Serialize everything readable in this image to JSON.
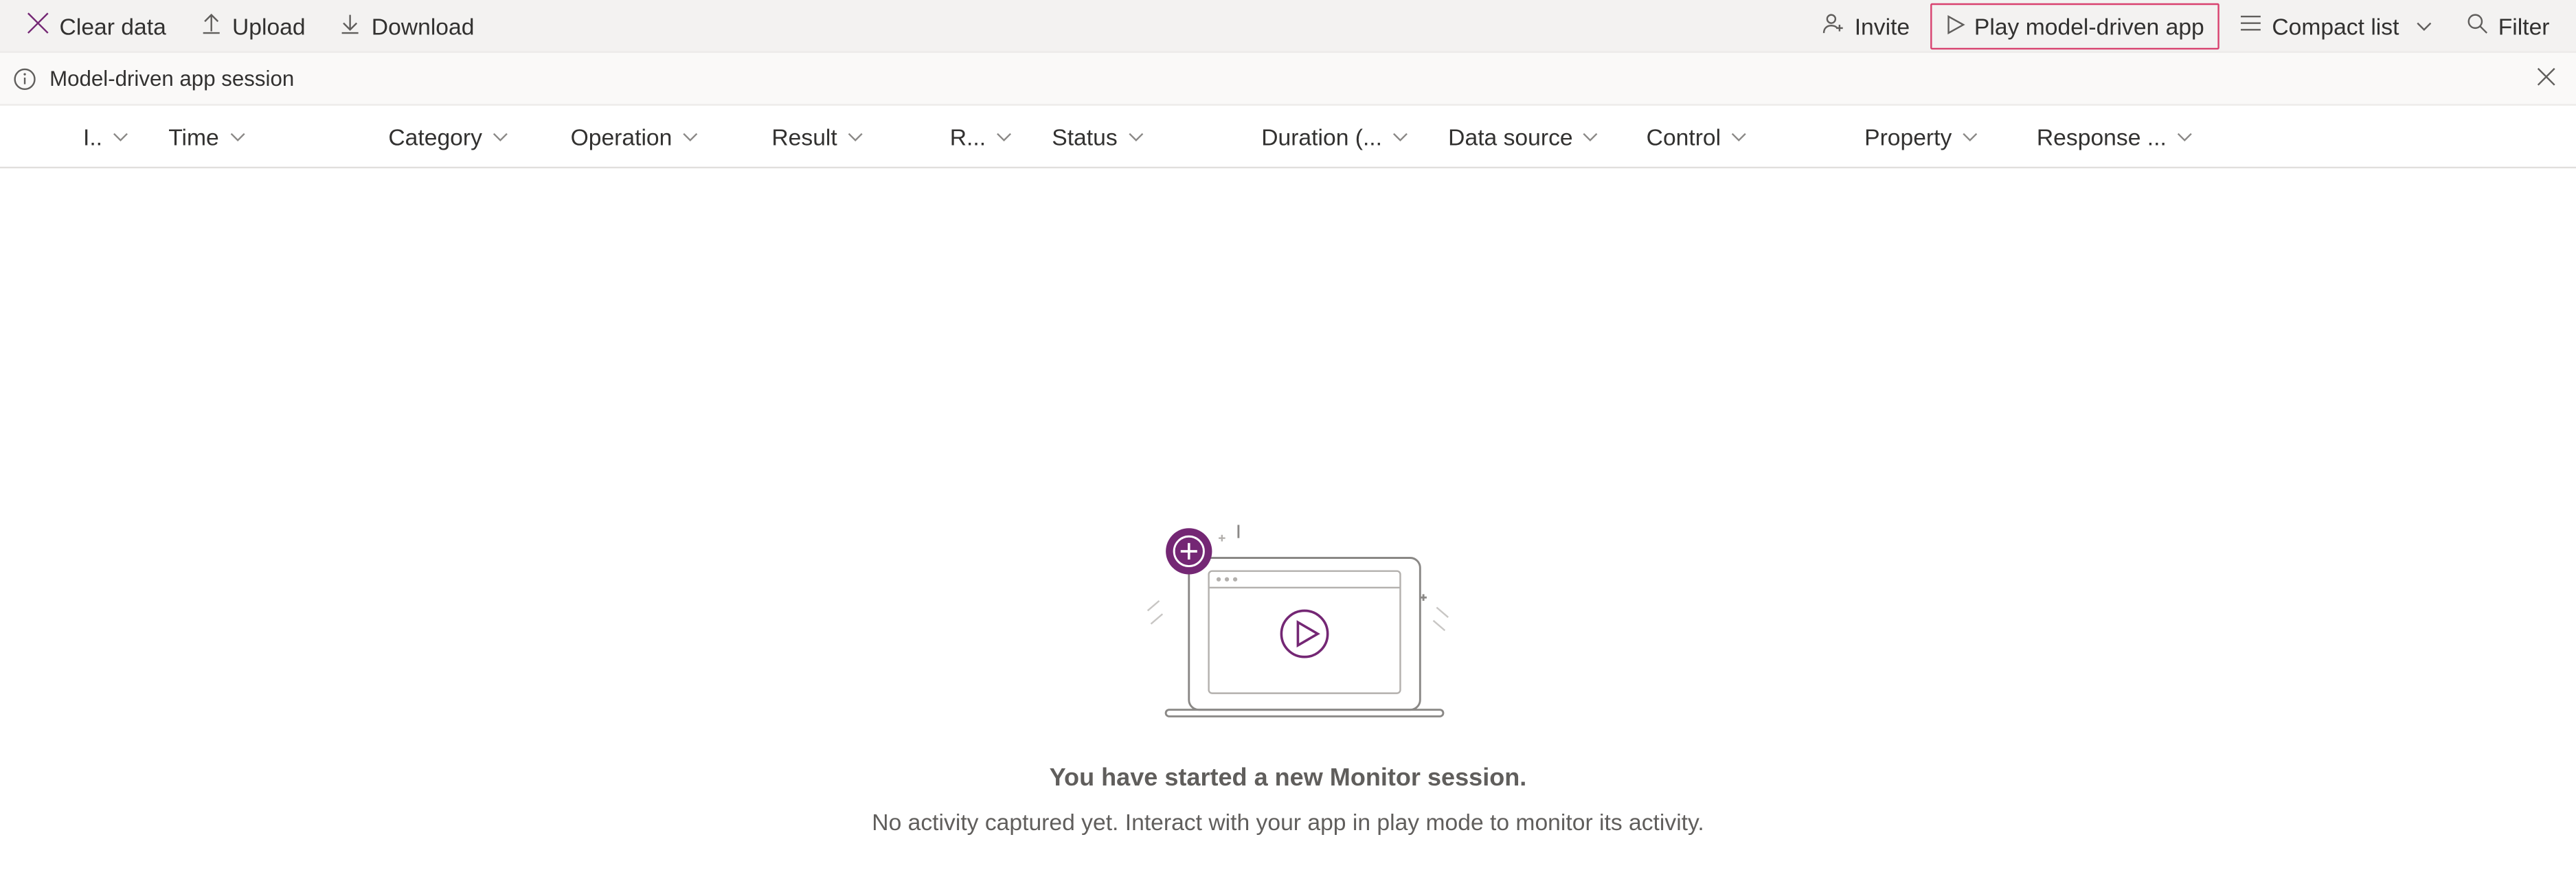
{
  "toolbar": {
    "clear_data": "Clear data",
    "upload": "Upload",
    "download": "Download",
    "invite": "Invite",
    "play_app": "Play model-driven app",
    "view_mode": "Compact list",
    "filter": "Filter"
  },
  "session": {
    "label": "Model-driven app session"
  },
  "columns": [
    {
      "label": "I.."
    },
    {
      "label": "Time"
    },
    {
      "label": "Category"
    },
    {
      "label": "Operation"
    },
    {
      "label": "Result"
    },
    {
      "label": "R..."
    },
    {
      "label": "Status"
    },
    {
      "label": "Duration (..."
    },
    {
      "label": "Data source"
    },
    {
      "label": "Control"
    },
    {
      "label": "Property"
    },
    {
      "label": "Response ..."
    }
  ],
  "empty": {
    "title": "You have started a new Monitor session.",
    "subtitle": "No activity captured yet. Interact with your app in play mode to monitor its activity."
  },
  "colors": {
    "accent": "#742774",
    "highlight_border": "#d8416f"
  }
}
